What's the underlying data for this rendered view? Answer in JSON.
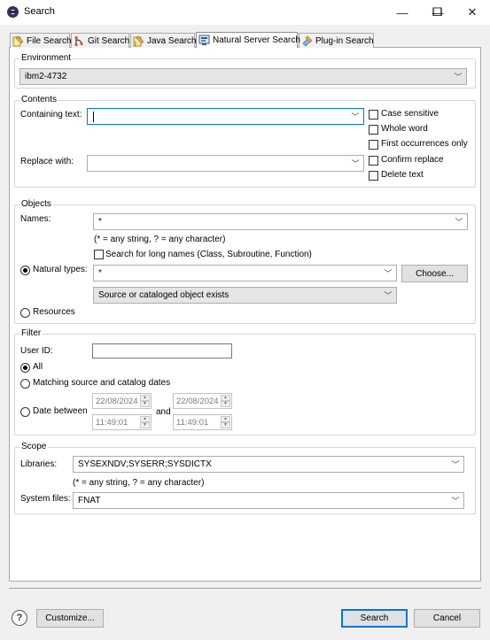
{
  "window": {
    "title": "Search",
    "minimize": "—",
    "maximize": "☐",
    "close": "✕"
  },
  "tabs": [
    {
      "label": "File Search"
    },
    {
      "label": "Git Search"
    },
    {
      "label": "Java Search"
    },
    {
      "label": "Natural Server Search"
    },
    {
      "label": "Plug-in Search"
    }
  ],
  "environment": {
    "label": "Environment",
    "value": "ibm2-4732"
  },
  "contents": {
    "label": "Contents",
    "containing_label": "Containing text:",
    "containing_value": "",
    "replace_label": "Replace with:",
    "replace_value": "",
    "options": {
      "case_sensitive": "Case sensitive",
      "whole_word": "Whole word",
      "first_occurrences": "First occurrences only",
      "confirm_replace": "Confirm replace",
      "delete_text": "Delete text"
    }
  },
  "objects": {
    "label": "Objects",
    "names_label": "Names:",
    "names_value": "*",
    "hint": "(* = any string, ? = any character)",
    "long_names": "Search for long names (Class, Subroutine, Function)",
    "natural_types_label": "Natural types:",
    "natural_types_value": "*",
    "choose_button": "Choose...",
    "existence_value": "Source or cataloged object exists",
    "resources_label": "Resources"
  },
  "filter": {
    "label": "Filter",
    "userid_label": "User ID:",
    "userid_value": "",
    "all_label": "All",
    "matching_label": "Matching source and catalog dates",
    "between_label": "Date between",
    "and_label": "and",
    "from_date": "22/08/2024",
    "from_time": "11:49:01",
    "to_date": "22/08/2024",
    "to_time": "11:49:01"
  },
  "scope": {
    "label": "Scope",
    "libraries_label": "Libraries:",
    "libraries_value": "SYSEXNDV;SYSERR;SYSDICTX",
    "hint": "(* = any string, ? = any character)",
    "systemfiles_label": "System files:",
    "systemfiles_value": "FNAT"
  },
  "footer": {
    "help": "?",
    "customize": "Customize...",
    "search": "Search",
    "cancel": "Cancel"
  }
}
